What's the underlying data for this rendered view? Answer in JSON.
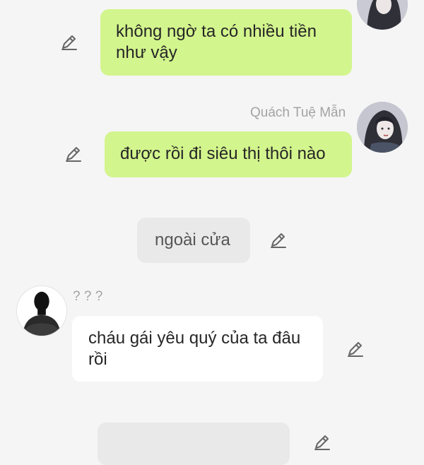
{
  "messages": [
    {
      "side": "right",
      "text": "không ngờ ta có nhiều tiền như vậy"
    },
    {
      "side": "right",
      "sender": "Quách Tuệ Mẫn",
      "text": "được rồi đi siêu thị thôi nào"
    },
    {
      "side": "center",
      "text": "ngoài cửa"
    },
    {
      "side": "left",
      "sender": "? ? ?",
      "text": "cháu gái yêu quý của ta đâu rồi"
    }
  ],
  "icons": {
    "edit": "pencil-edit-icon",
    "avatar_girl": "anime-girl-avatar",
    "avatar_unknown": "silhouette-avatar"
  },
  "colors": {
    "background": "#f5f5f5",
    "green_bubble": "#d3f58d",
    "white_bubble": "#ffffff",
    "gray_bubble": "#e9e9e9",
    "name_text": "#a3a3a3"
  }
}
